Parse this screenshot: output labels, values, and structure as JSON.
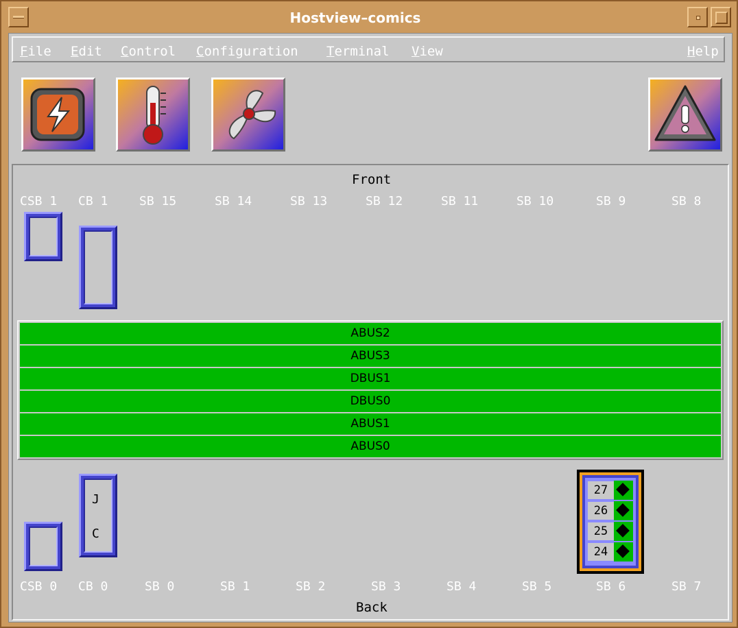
{
  "window": {
    "title": "Hostview–comics"
  },
  "menubar": {
    "items": [
      {
        "label": "File",
        "mnemonic": "F",
        "rest": "ile"
      },
      {
        "label": "Edit",
        "mnemonic": "E",
        "rest": "dit"
      },
      {
        "label": "Control",
        "mnemonic": "C",
        "rest": "ontrol"
      },
      {
        "label": "Configuration",
        "mnemonic": "C",
        "rest": "onfiguration"
      },
      {
        "label": "Terminal",
        "mnemonic": "T",
        "rest": "erminal"
      },
      {
        "label": "View",
        "mnemonic": "V",
        "rest": "iew"
      },
      {
        "label": "Help",
        "mnemonic": "H",
        "rest": "elp"
      }
    ]
  },
  "toolbar": {
    "icons": [
      "power-icon",
      "thermometer-icon",
      "fan-icon",
      "warning-icon"
    ]
  },
  "panel": {
    "front_label": "Front",
    "back_label": "Back",
    "front_slots": [
      "CSB 1",
      "CB 1",
      "SB 15",
      "SB 14",
      "SB 13",
      "SB 12",
      "SB 11",
      "SB 10",
      "SB 9",
      "SB 8"
    ],
    "back_slots": [
      "CSB 0",
      "CB 0",
      "SB 0",
      "SB 1",
      "SB 2",
      "SB 3",
      "SB 4",
      "SB 5",
      "SB 6",
      "SB 7"
    ],
    "buses": [
      "ABUS2",
      "ABUS3",
      "DBUS1",
      "DBUS0",
      "ABUS1",
      "ABUS0"
    ],
    "cb0_letters": [
      "J",
      "C"
    ],
    "sb6_cpus": [
      "27",
      "26",
      "25",
      "24"
    ]
  },
  "colors": {
    "bus_ok": "#00b800",
    "board": "#4444cc",
    "window_frame": "#cc9a5e",
    "selected_board": "#f0a020"
  }
}
